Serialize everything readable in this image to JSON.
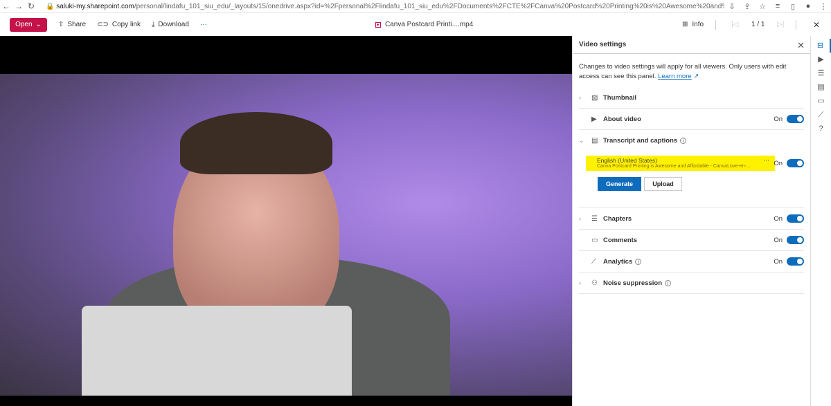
{
  "browser": {
    "url_domain": "saluki-my.sharepoint.com",
    "url_path": "/personal/lindafu_101_siu_edu/_layouts/15/onedrive.aspx?id=%2Fpersonal%2Flindafu_101_siu_edu%2FDocuments%2FCTE%2FCanva%20Postcard%20Printing%20is%20Awesome%20and%20Affordable%20-%20CanvaLove..."
  },
  "toolbar": {
    "open": "Open",
    "share": "Share",
    "copy_link": "Copy link",
    "download": "Download",
    "more": "···",
    "file_name": "Canva Postcard Printi....mp4",
    "info": "Info",
    "page": "1 / 1"
  },
  "panel": {
    "title": "Video settings",
    "description": "Changes to video settings will apply for all viewers. Only users with edit access can see this panel.",
    "learn_more": "Learn more",
    "thumbnail": "Thumbnail",
    "about_video": "About video",
    "transcript": "Transcript and captions",
    "caption_language": "English (United States)",
    "caption_file": "Canva Postcard Printing is Awesome and Affordable - CanvaLove-en-...",
    "generate": "Generate",
    "upload": "Upload",
    "chapters": "Chapters",
    "comments": "Comments",
    "analytics": "Analytics",
    "noise": "Noise suppression",
    "on": "On"
  },
  "colors": {
    "accent": "#0f6cbd",
    "open_button": "#c4134a",
    "highlight": "#fff200"
  }
}
